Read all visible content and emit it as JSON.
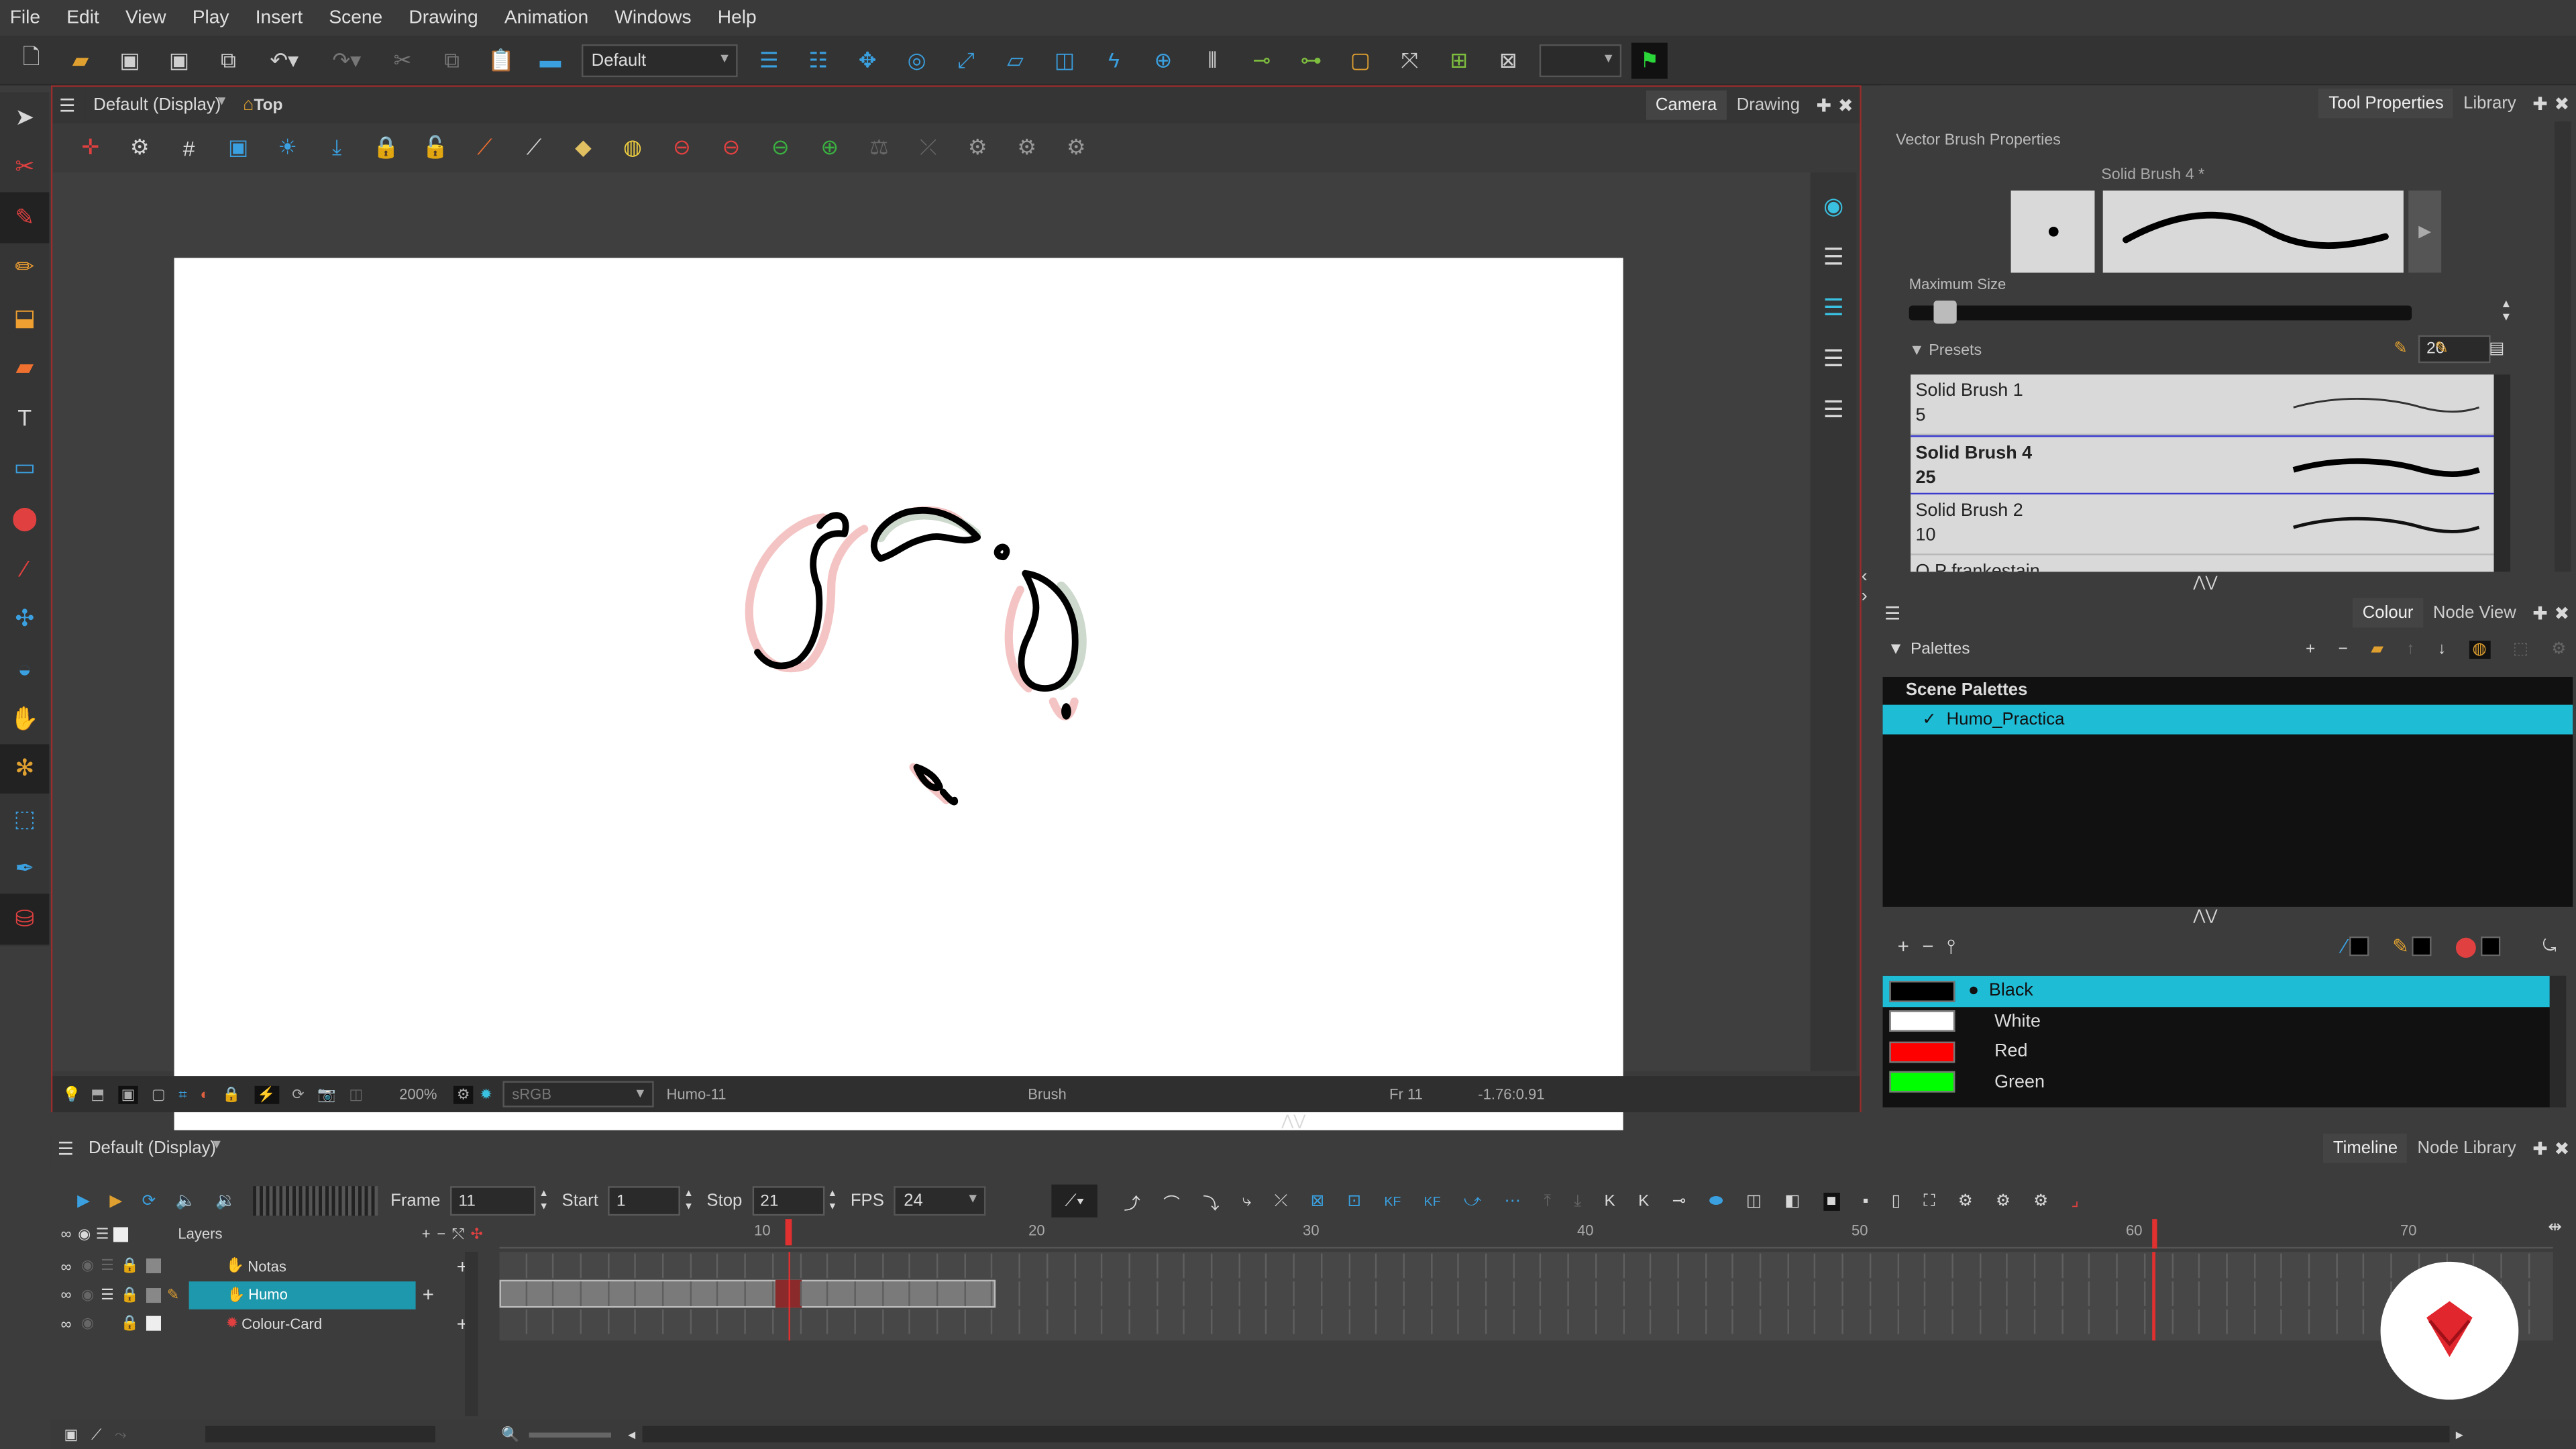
{
  "menu": [
    "File",
    "Edit",
    "View",
    "Play",
    "Insert",
    "Scene",
    "Drawing",
    "Animation",
    "Windows",
    "Help"
  ],
  "toolbar": {
    "workspace": "Default"
  },
  "view": {
    "title": "Default (Display)",
    "top_label": "Top",
    "tabs": [
      "Camera",
      "Drawing"
    ]
  },
  "status": {
    "zoom": "200%",
    "colorspace": "sRGB",
    "drawing": "Humo-11",
    "tool": "Brush",
    "frame": "Fr 11",
    "coords": "-1.76:0.91"
  },
  "toolprops": {
    "tabs": [
      "Tool Properties",
      "Library"
    ],
    "header": "Vector Brush Properties",
    "brush_name": "Solid Brush 4 *",
    "max_size_label": "Maximum Size",
    "max_size_value": "20",
    "max_size_fraction": 0.05,
    "presets_label": "Presets",
    "presets": [
      {
        "name": "Solid Brush 1",
        "size": "5"
      },
      {
        "name": "Solid Brush 4",
        "size": "25"
      },
      {
        "name": "Solid Brush 2",
        "size": "10"
      },
      {
        "name": "O.P frankestain",
        "size": ""
      }
    ]
  },
  "colour": {
    "tabs": [
      "Colour",
      "Node View"
    ],
    "palettes_label": "Palettes",
    "scene_palettes_label": "Scene Palettes",
    "palette_name": "Humo_Practica",
    "colours": [
      {
        "name": "Black",
        "hex": "#000000"
      },
      {
        "name": "White",
        "hex": "#ffffff"
      },
      {
        "name": "Red",
        "hex": "#ff0000"
      },
      {
        "name": "Green",
        "hex": "#00ff00"
      }
    ]
  },
  "timeline": {
    "view_title": "Default (Display)",
    "tabs": [
      "Timeline",
      "Node Library"
    ],
    "frame_label": "Frame",
    "frame": "11",
    "start_label": "Start",
    "start": "1",
    "stop_label": "Stop",
    "stop": "21",
    "fps_label": "FPS",
    "fps": "24",
    "layers_label": "Layers",
    "layers": [
      "Notas",
      "Humo",
      "Colour-Card"
    ],
    "ruler": [
      "10",
      "20",
      "30",
      "40",
      "50",
      "60",
      "70"
    ],
    "kf": "KF"
  }
}
